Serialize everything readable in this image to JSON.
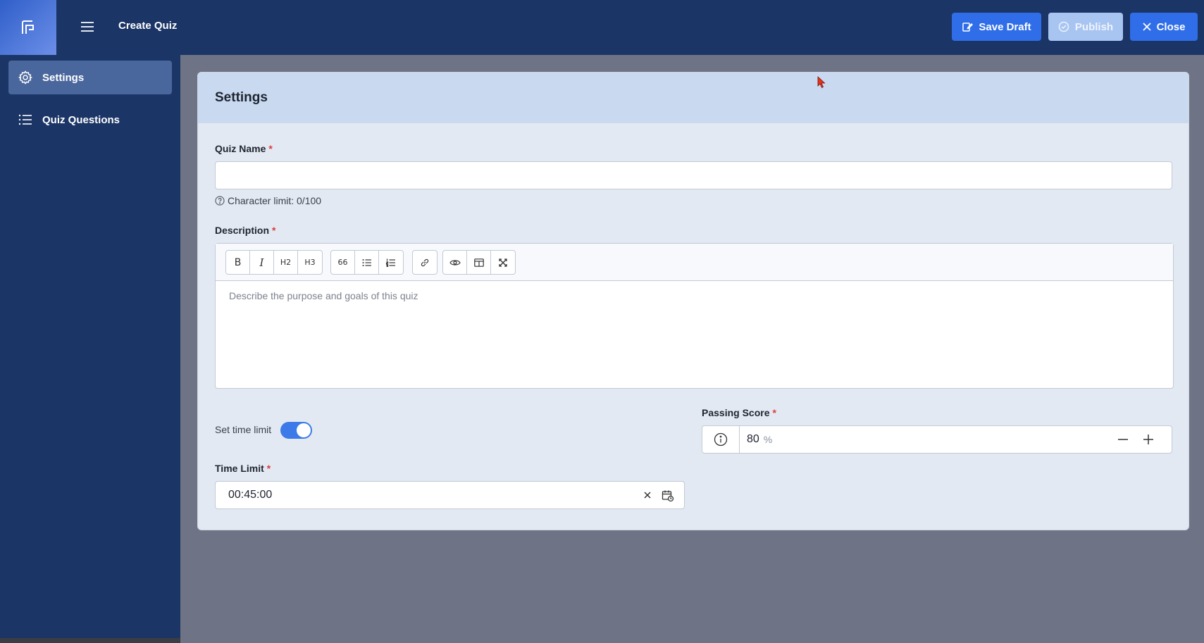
{
  "header": {
    "title": "Create Quiz",
    "save_label": "Save Draft",
    "publish_label": "Publish",
    "close_label": "Close"
  },
  "sidebar": {
    "items": [
      {
        "label": "Settings",
        "icon": "gear-icon",
        "active": true
      },
      {
        "label": "Quiz Questions",
        "icon": "list-icon",
        "active": false
      }
    ]
  },
  "card": {
    "title": "Settings"
  },
  "quiz_name": {
    "label": "Quiz Name",
    "required_mark": "*",
    "value": "",
    "help": "Character limit: 0/100"
  },
  "description": {
    "label": "Description",
    "required_mark": "*",
    "placeholder": "Describe the purpose and goals of this quiz",
    "toolbar": {
      "bold": "B",
      "italic": "I",
      "h2": "H2",
      "h3": "H3",
      "quote": "66"
    }
  },
  "time_limit_toggle": {
    "label": "Set time limit",
    "enabled": true
  },
  "time_limit": {
    "label": "Time Limit",
    "required_mark": "*",
    "value": "00:45:00"
  },
  "passing_score": {
    "label": "Passing Score",
    "required_mark": "*",
    "value": "80",
    "unit": "%"
  },
  "colors": {
    "header_bg": "#1b3566",
    "primary": "#2f6ee8",
    "card_header": "#c8d9f0",
    "required": "#e03b3b"
  }
}
